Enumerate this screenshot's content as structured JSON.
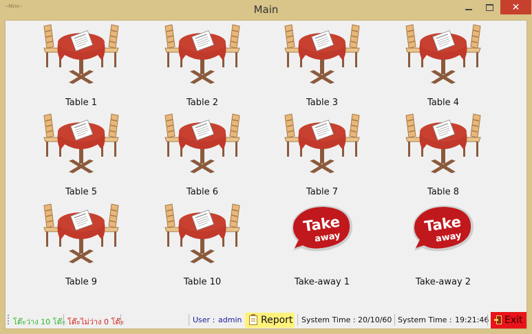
{
  "window": {
    "title": "Main",
    "app_icon_text": "~Mein~",
    "close_glyph": "✕"
  },
  "tables": [
    {
      "label": "Table 1",
      "icon": "table-icon"
    },
    {
      "label": "Table 2",
      "icon": "table-icon"
    },
    {
      "label": "Table 3",
      "icon": "table-icon"
    },
    {
      "label": "Table 4",
      "icon": "table-icon"
    },
    {
      "label": "Table 5",
      "icon": "table-icon"
    },
    {
      "label": "Table 6",
      "icon": "table-icon"
    },
    {
      "label": "Table 7",
      "icon": "table-icon"
    },
    {
      "label": "Table 8",
      "icon": "table-icon"
    },
    {
      "label": "Table 9",
      "icon": "table-icon"
    },
    {
      "label": "Table 10",
      "icon": "table-icon"
    },
    {
      "label": "Take-away 1",
      "icon": "takeaway-icon",
      "badge_top": "Take",
      "badge_bottom": "away"
    },
    {
      "label": "Take-away 2",
      "icon": "takeaway-icon",
      "badge_top": "Take",
      "badge_bottom": "away"
    }
  ],
  "status": {
    "free_tables": "โต๊ะว่าง 10 โต๊ะ",
    "busy_tables": "โต๊ะไม่ว่าง 0 โต๊ะ",
    "user_label": "User :",
    "user_name": "admin",
    "report_label": "Report",
    "system_time_label_1": "System Time :",
    "system_date": "20/10/60",
    "system_time_label_2": "System Time :",
    "system_time": "19:21:46",
    "exit_label": "Exit"
  },
  "colors": {
    "title_bar": "#d9c48a",
    "close_button": "#c7402d",
    "client_bg": "#f0f0f0",
    "table_cloth": "#c0392b",
    "chair": "#e8b77a",
    "table_base": "#8b5a3c",
    "free_text": "#2bb52b",
    "busy_text": "#d42020",
    "report_bg": "#fff27a",
    "exit_bg": "#e8141b"
  }
}
